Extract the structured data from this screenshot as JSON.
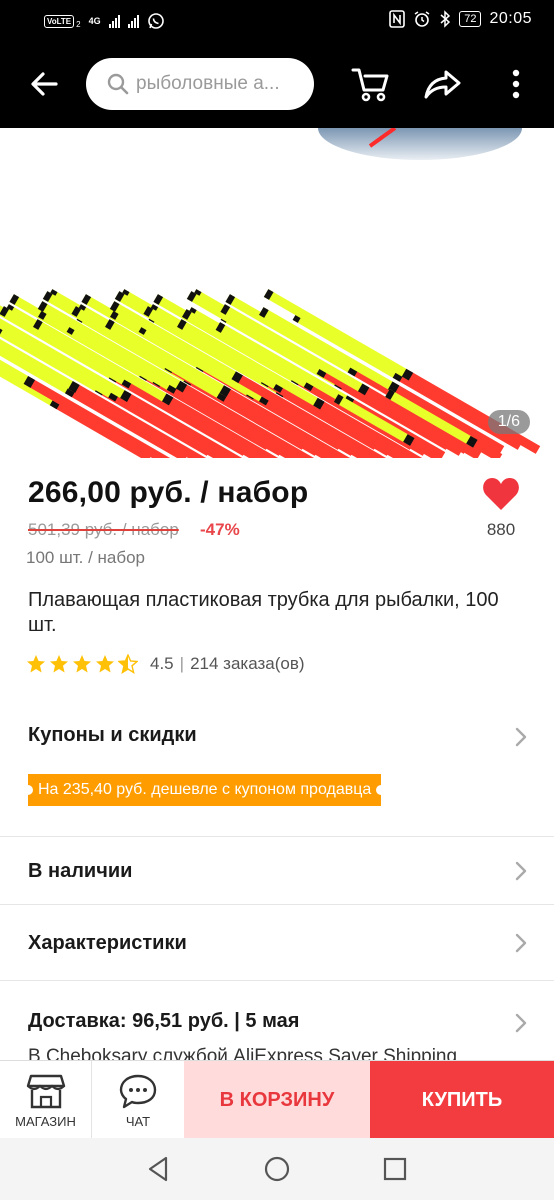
{
  "status_bar": {
    "volte": "VoLTE",
    "sim": "2",
    "network": "4G",
    "battery": "72",
    "time": "20:05"
  },
  "app_bar": {
    "search_placeholder": "рыболовные а...",
    "icons": [
      "back-arrow-icon",
      "search-icon",
      "cart-icon",
      "share-icon",
      "more-icon"
    ]
  },
  "gallery": {
    "counter": "1/6",
    "colors": {
      "red": "#ff3b30",
      "yellow": "#e9ff2a",
      "black": "#111111"
    }
  },
  "product": {
    "price": "266,00 руб. / набор",
    "old_price": "501,39 руб. / набор",
    "discount": "-47%",
    "unit": "100 шт. / набор",
    "favorites": "880",
    "title": "Плавающая пластиковая трубка для рыбалки, 100 шт.",
    "rating": 4.5,
    "rating_text": "4.5",
    "orders_text": "214 заказа(ов)"
  },
  "sections": {
    "coupons": "Купоны и скидки",
    "coupon_badge": "На 235,40 руб. дешевле с купоном продавца",
    "in_stock": "В наличии",
    "specs": "Характеристики",
    "delivery": "Доставка: 96,51 руб. | 5 мая",
    "delivery_sub": "В Cheboksary службой AliExpress Saver Shipping"
  },
  "action_bar": {
    "store": "МАГАЗИН",
    "chat": "ЧАТ",
    "add_to_cart": "В КОРЗИНУ",
    "buy": "КУПИТЬ"
  },
  "colors": {
    "accent_red": "#f23c3f",
    "cart_bg": "#ffdcdb",
    "coupon_orange": "#ff9c00",
    "star_yellow": "#ffc107"
  }
}
